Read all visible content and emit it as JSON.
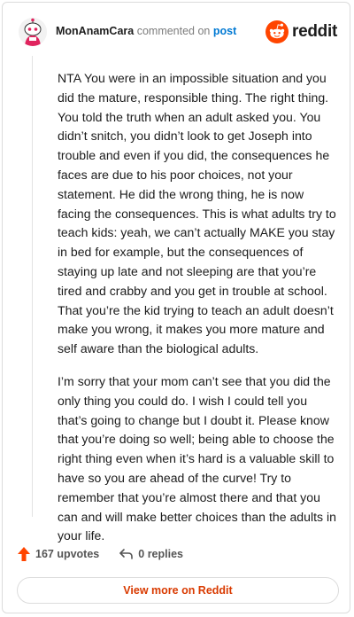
{
  "comment": {
    "author": "MonAnamCara",
    "commented_on_text": "commented on",
    "post_link_text": "post",
    "paragraphs": [
      "NTA You were in an impossible situation and you did the mature, responsible thing. The right thing. You told the truth when an adult asked you. You didn’t snitch, you didn’t look to get Joseph into trouble and even if you did, the consequences he faces are due to his poor choices, not your statement. He did the wrong thing, he is now facing the consequences. This is what adults try to teach kids: yeah, we can’t actually MAKE you stay in bed for example, but the consequences of staying up late and not sleeping are that you’re tired and crabby and you get in trouble at school. That you’re the kid trying to teach an adult doesn’t make you wrong, it makes you more mature and self aware than the biological adults.",
      "I’m sorry that your mom can’t see that you did the only thing you could do. I wish I could tell you that’s going to change but I doubt it. Please know that you’re doing so well; being able to choose the right thing even when it’s hard is a valuable skill to have so you are ahead of the curve! Try to remember that you’re almost there and that you can and will make better choices than the adults in your life."
    ],
    "upvotes_label": "167 upvotes",
    "replies_label": "0 replies"
  },
  "brand": {
    "name": "reddit",
    "icon": "reddit-logo-icon",
    "color": "#ff4500"
  },
  "footer": {
    "view_more_label": "View more on Reddit"
  },
  "colors": {
    "accent": "#ff4500",
    "link": "#0079d3",
    "view_more_text": "#d93a00"
  }
}
